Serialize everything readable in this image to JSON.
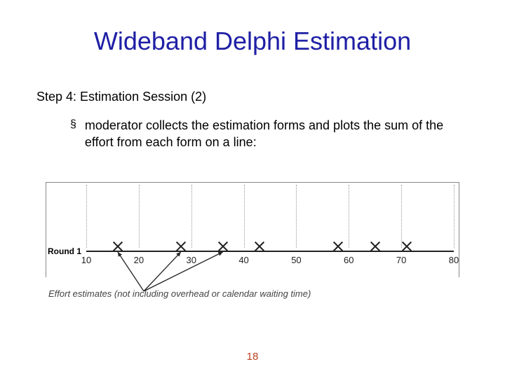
{
  "title": "Wideband Delphi Estimation",
  "subtitle": "Step 4: Estimation Session (2)",
  "bullet": "moderator collects the estimation forms and plots the sum of the effort from each form on a line:",
  "page_number": "18",
  "chart_data": {
    "type": "scatter",
    "title": "",
    "row_label": "Round 1",
    "xlabel": "Effort estimates (not including overhead or calendar waiting time)",
    "ylabel": "",
    "ticks": [
      10,
      20,
      30,
      40,
      50,
      60,
      70,
      80
    ],
    "xlim": [
      10,
      80
    ],
    "points_x": [
      16,
      28,
      36,
      43,
      58,
      65,
      71
    ],
    "arrows_from_caption_to_points": [
      16,
      28,
      36
    ]
  }
}
